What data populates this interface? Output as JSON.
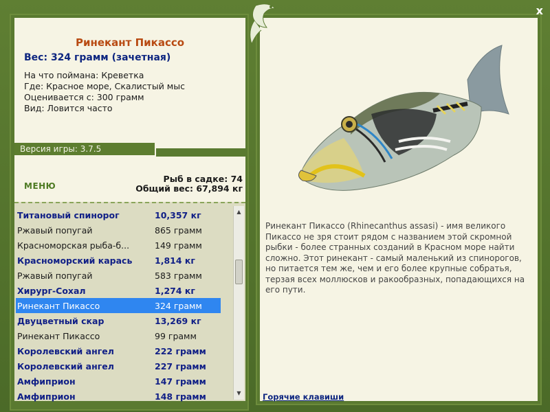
{
  "window": {
    "close_label": "x"
  },
  "fish_info": {
    "title": "Ринекант Пикассо",
    "weight_line": "Вес: 324 грамм (зачетная)",
    "lines": [
      "На что поймана: Креветка",
      "Где: Красное море, Скалистый мыс",
      "Оценивается с: 300 грамм",
      "Вид: Ловится часто"
    ]
  },
  "version": "Версия игры: 3.7.5",
  "menu_label": "МЕНЮ",
  "stats": {
    "cage": "Рыб в садке: 74",
    "total": "Общий вес: 67,894 кг"
  },
  "fish_list": [
    {
      "name": "Титановый спинорог",
      "weight": "10,357 кг",
      "record": true
    },
    {
      "name": "Ржавый попугай",
      "weight": "865 грамм",
      "record": false
    },
    {
      "name": "Красноморская рыба-б...",
      "weight": "149 грамм",
      "record": false
    },
    {
      "name": "Красноморский карась",
      "weight": "1,814 кг",
      "record": true
    },
    {
      "name": "Ржавый попугай",
      "weight": "583 грамм",
      "record": false
    },
    {
      "name": "Хирург-Сохал",
      "weight": "1,274 кг",
      "record": true
    },
    {
      "name": "Ринекант Пикассо",
      "weight": "324 грамм",
      "record": true,
      "selected": true
    },
    {
      "name": "Двуцветный скар",
      "weight": "13,269 кг",
      "record": true
    },
    {
      "name": "Ринекант Пикассо",
      "weight": "99 грамм",
      "record": false
    },
    {
      "name": "Королевский ангел",
      "weight": "222 грамм",
      "record": true
    },
    {
      "name": "Королевский ангел",
      "weight": "227 грамм",
      "record": true
    },
    {
      "name": "Амфиприон",
      "weight": "147 грамм",
      "record": true
    },
    {
      "name": "Амфиприон",
      "weight": "148 грамм",
      "record": true
    }
  ],
  "description": "Ринекант Пикассо (Rhinecanthus assasi) - имя великого Пикассо не зря стоит рядом с названием этой скромной рыбки - более странных созданий в Красном море найти сложно. Этот ринекант - самый маленький из спинорогов, но питается тем же, чем и его более крупные собратья, терзая всех моллюсков и ракообразных, попадающихся на его пути.",
  "hotkeys_label": "Горячие клавиши",
  "icons": [
    "close-icon",
    "gecko-emblem-icon",
    "scroll-up-icon",
    "scroll-down-icon",
    "fish-picture"
  ],
  "colors": {
    "frame_green": "#5a7a30",
    "panel_bg": "#f6f4e4",
    "list_bg": "#dcdcc2",
    "title_color": "#b84a12",
    "record_color": "#101f86",
    "selected_bg": "#2f86f0"
  }
}
